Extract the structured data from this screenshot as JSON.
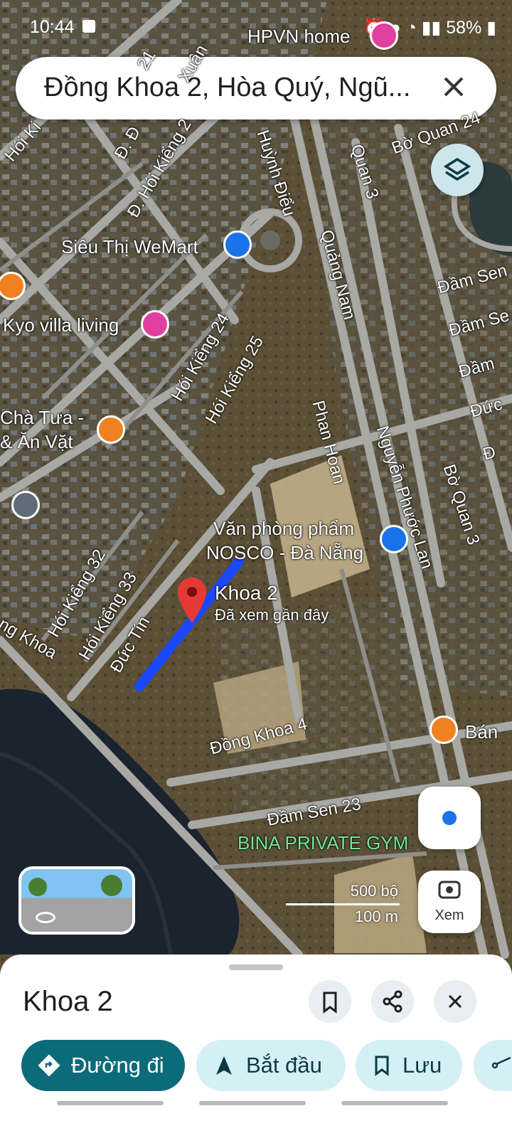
{
  "status_bar": {
    "time": "10:44",
    "battery": "58%"
  },
  "search": {
    "query": "Đồng Khoa 2, Hòa Quý, Ngũ..."
  },
  "map": {
    "place_labels": {
      "hpvn_home": "HPVN home",
      "wemart": "Siêu Thị WeMart",
      "kyo_villa": "Kyo villa living",
      "cha_tua_line1": "Chà Tưa -",
      "cha_tua_line2": "& Ăn Vặt",
      "van_phong_pham_line1": "Văn phòng phẩm",
      "van_phong_pham_line2": "NOSCO - Đà Nẵng",
      "pin_title": "Khoa 2",
      "pin_subtitle": "Đã xem gần đây",
      "bina_gym": "BINA PRIVATE GYM",
      "banh": "Bán"
    },
    "road_labels": {
      "hoi_kieng_24": "Hói Kiểng 24",
      "hoi_kieng_25": "Hói Kiểng 25",
      "hoi_kieng_32": "Hói Kiểng 32",
      "hoi_kieng_33": "Hói Kiểng 33",
      "d_hoi_kieng_2": "Đ. Hói Kiểng 2",
      "d_d": "Đ. Đ",
      "hoi_ki": "Hói Ki",
      "r21": "21",
      "xuan": "Xuân",
      "huynh_dieu": "Huỳnh Điểu",
      "quang_nam": "Quảng Nam",
      "quan_3": "Quan 3",
      "bo_quan_24": "Bờ Quan 24",
      "phan_hoan": "Phan Hoan",
      "nguyen_phuoc_lan": "Nguyễn Phước Lan",
      "bo_quan_3": "Bờ Quan 3",
      "dam_sen_1": "Đầm Sen",
      "dam_se": "Đầm Se",
      "dam_s": "Đầm",
      "duc": "Đức",
      "d_small": "Đ",
      "duc_tin": "Đức Tín",
      "dong_khoa": "ng Khoa",
      "dong_khoa_4": "Đồng Khoa 4",
      "dam_sen_23": "Đầm Sen 23"
    },
    "scale": {
      "top": "500 bộ",
      "bottom": "100 m"
    },
    "camera_label": "Xem",
    "colors": {
      "route": "#1a47ff",
      "pin": "#e53935",
      "poi_blue": "#1a73e8",
      "poi_pink": "#e040a0",
      "poi_orange": "#f08020",
      "accent": "#0b6b79"
    }
  },
  "sheet": {
    "title": "Khoa 2",
    "buttons": {
      "directions": "Đường đi",
      "start": "Bắt đầu",
      "save": "Lưu"
    }
  }
}
